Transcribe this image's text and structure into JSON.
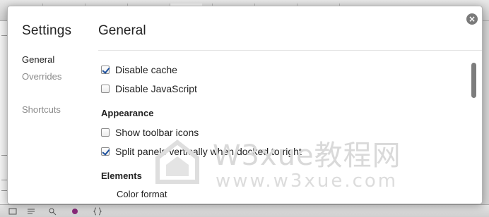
{
  "settings": {
    "sidebar_title": "Settings",
    "nav": [
      {
        "label": "General",
        "active": true
      },
      {
        "label": "Overrides",
        "active": false
      },
      {
        "label": "Shortcuts",
        "active": false
      }
    ],
    "main_title": "General",
    "close_icon": "close-icon",
    "options": [
      {
        "label": "Disable cache",
        "checked": true
      },
      {
        "label": "Disable JavaScript",
        "checked": false
      }
    ],
    "appearance": {
      "heading": "Appearance",
      "options": [
        {
          "label": "Show toolbar icons",
          "checked": false
        },
        {
          "label": "Split panels vertically when docked to right",
          "checked": true
        }
      ]
    },
    "elements": {
      "heading": "Elements",
      "color_format_label": "Color format"
    }
  },
  "watermark": {
    "line1": "W3xue教程网",
    "line2": "www.w3xue.com"
  },
  "colors": {
    "checkmark": "#1a4e9c",
    "close_button": "#7a7a7a",
    "scroll_thumb": "#7d7d7d"
  }
}
